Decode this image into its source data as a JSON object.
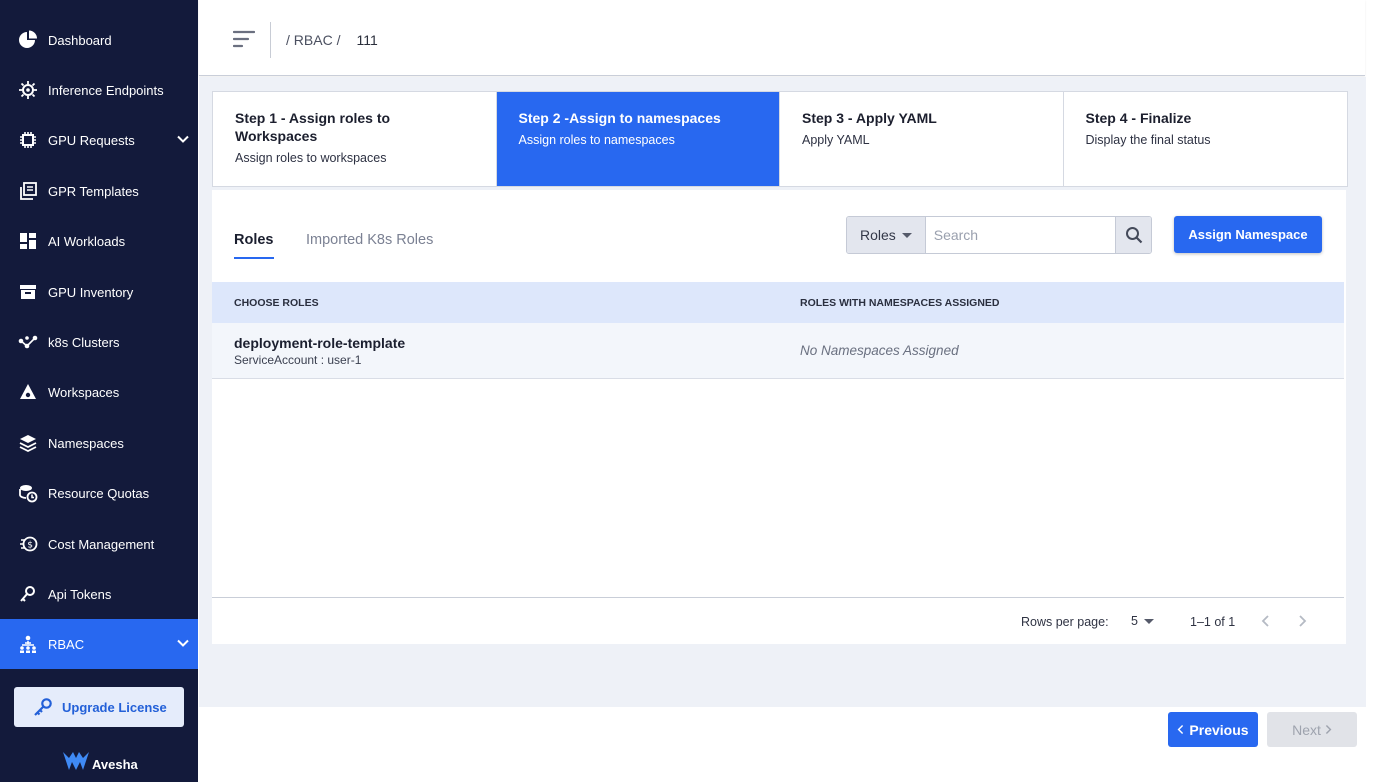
{
  "sidebar": {
    "items": [
      {
        "label": "Dashboard",
        "icon": "pie-chart-icon"
      },
      {
        "label": "Inference Endpoints",
        "icon": "chip-gear-icon"
      },
      {
        "label": "GPU Requests",
        "icon": "chip-icon"
      },
      {
        "label": "GPR Templates",
        "icon": "copy-icon"
      },
      {
        "label": "AI Workloads",
        "icon": "dashboard-grid-icon"
      },
      {
        "label": "GPU Inventory",
        "icon": "archive-box-icon"
      },
      {
        "label": "k8s Clusters",
        "icon": "nodes-icon"
      },
      {
        "label": "Workspaces",
        "icon": "workspaces-icon"
      },
      {
        "label": "Namespaces",
        "icon": "layers-icon"
      },
      {
        "label": "Resource Quotas",
        "icon": "quota-clock-icon"
      },
      {
        "label": "Cost Management",
        "icon": "coins-icon"
      },
      {
        "label": "Api Tokens",
        "icon": "key-icon"
      },
      {
        "label": "RBAC",
        "icon": "rbac-people-icon"
      }
    ],
    "upgrade_label": "Upgrade License",
    "logo_text": "Avesha"
  },
  "header": {
    "breadcrumb_root": "/ RBAC /",
    "breadcrumb_current": "111"
  },
  "steps": [
    {
      "title": "Step 1 - Assign roles to Workspaces",
      "subtitle": "Assign roles to workspaces"
    },
    {
      "title": "Step 2 -Assign to namespaces",
      "subtitle": "Assign roles to namespaces"
    },
    {
      "title": "Step 3 - Apply YAML",
      "subtitle": "Apply YAML"
    },
    {
      "title": "Step 4 - Finalize",
      "subtitle": "Display the final status"
    }
  ],
  "tabs": {
    "roles": "Roles",
    "imported": "Imported K8s Roles"
  },
  "filter": {
    "select_value": "Roles",
    "search_placeholder": "Search"
  },
  "assign_label": "Assign Namespace",
  "table": {
    "col_choose": "CHOOSE ROLES",
    "col_assigned": "ROLES WITH NAMESPACES ASSIGNED",
    "rows": [
      {
        "name": "deployment-role-template",
        "sub": "ServiceAccount : user-1",
        "namespaces": "No Namespaces Assigned"
      }
    ]
  },
  "pagination": {
    "rows_per_page_label": "Rows per page:",
    "rows_per_page": "5",
    "range": "1–1 of 1"
  },
  "nav": {
    "previous": "Previous",
    "next": "Next"
  },
  "colors": {
    "sidebar_bg": "#131a3b",
    "accent": "#2868f0"
  }
}
